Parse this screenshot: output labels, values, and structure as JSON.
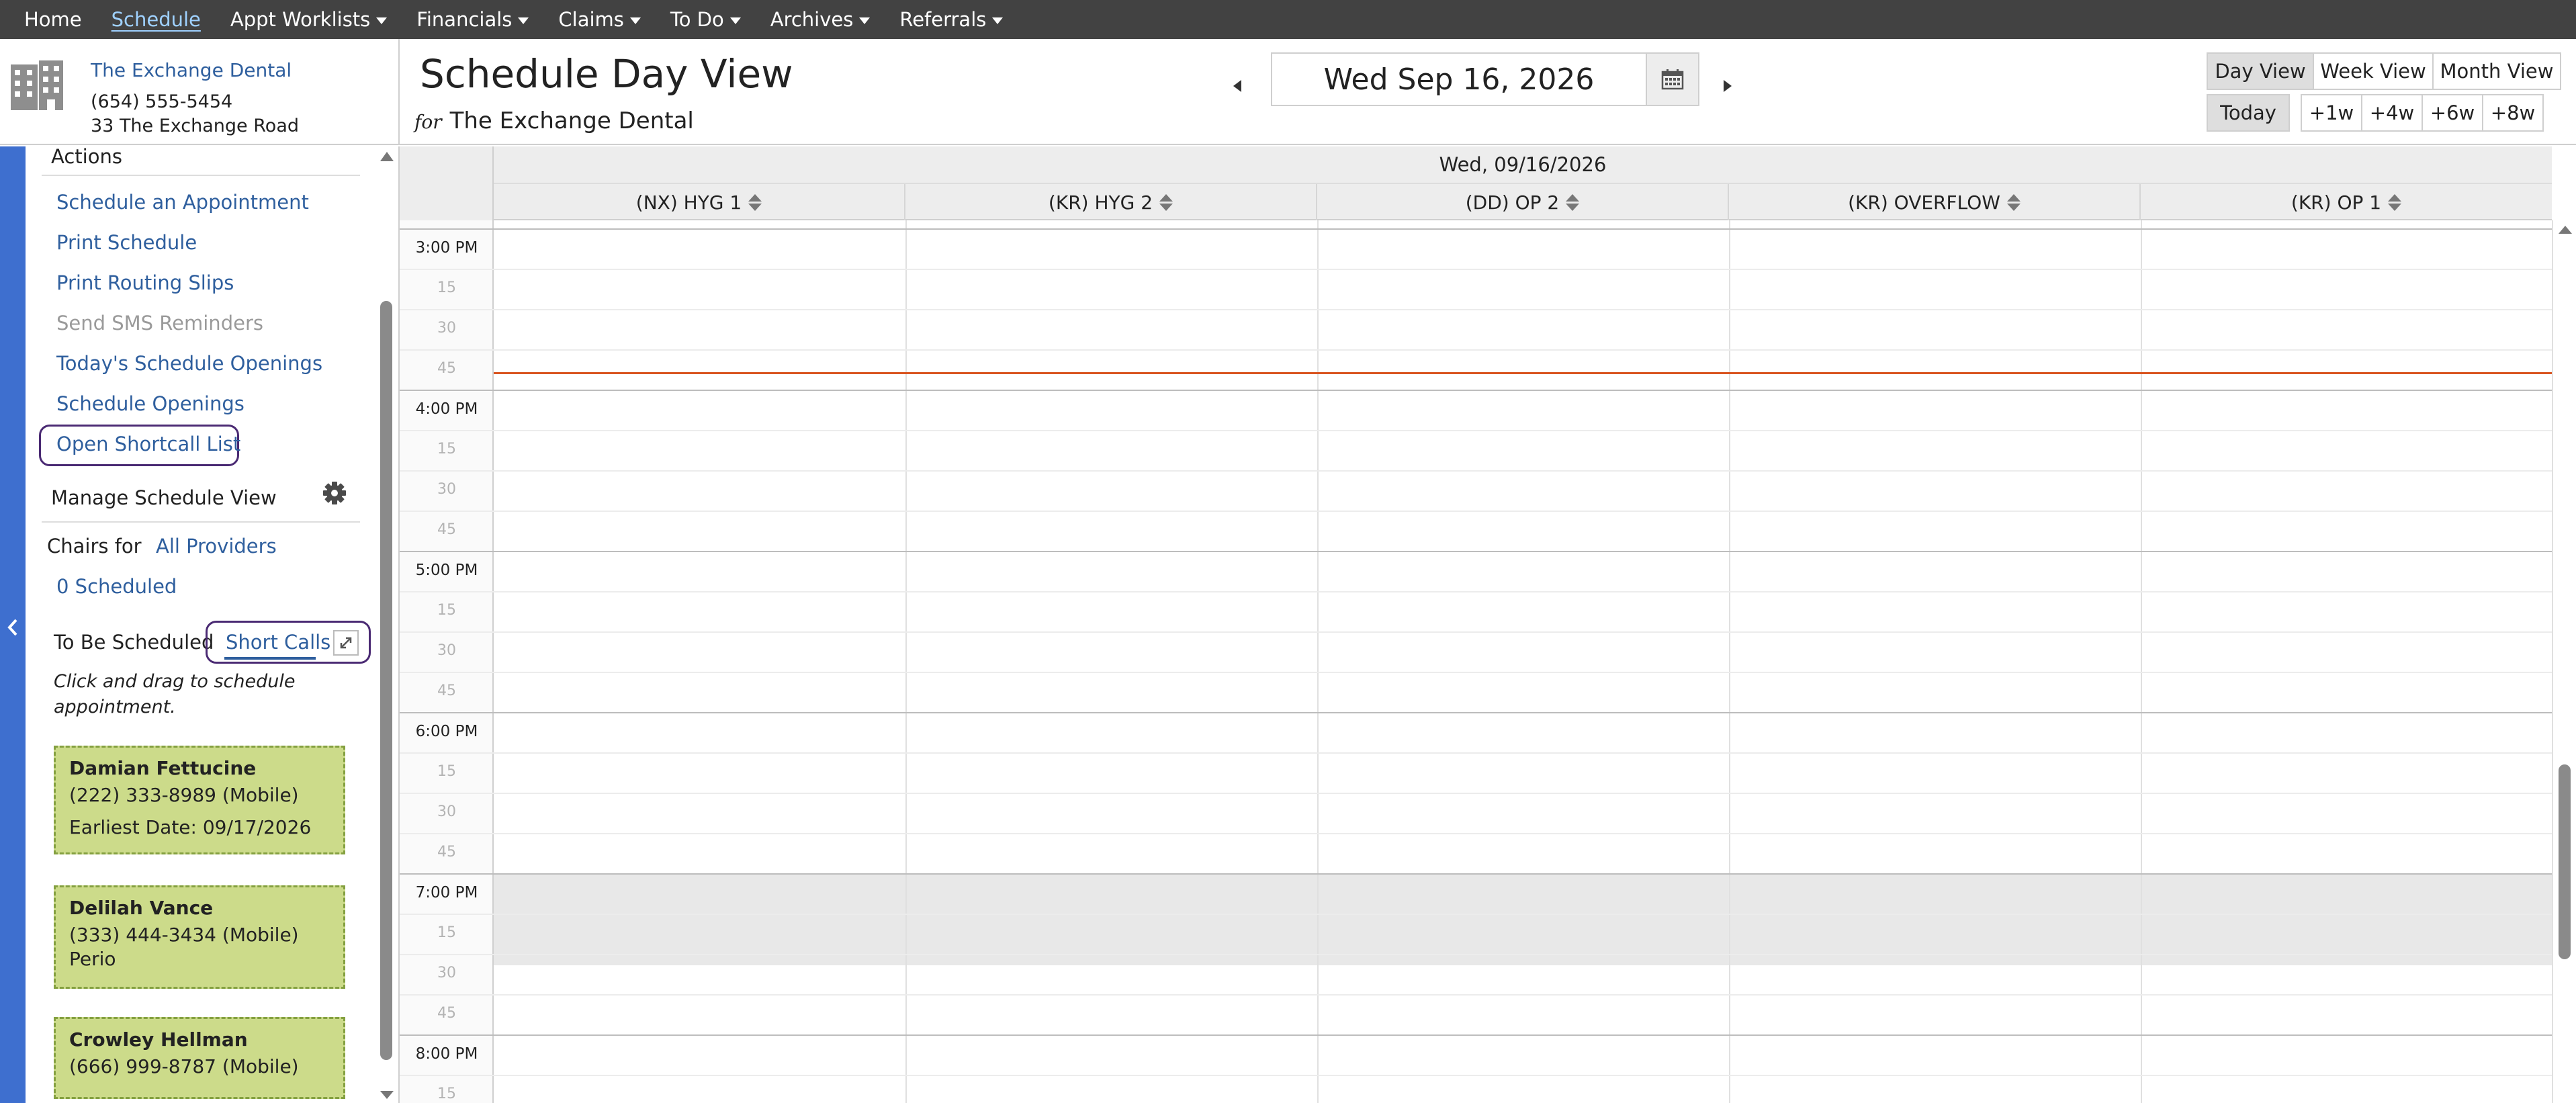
{
  "nav": {
    "items": [
      {
        "label": "Home",
        "dropdown": false,
        "active": false
      },
      {
        "label": "Schedule",
        "dropdown": false,
        "active": true
      },
      {
        "label": "Appt Worklists",
        "dropdown": true,
        "active": false
      },
      {
        "label": "Financials",
        "dropdown": true,
        "active": false
      },
      {
        "label": "Claims",
        "dropdown": true,
        "active": false
      },
      {
        "label": "To Do",
        "dropdown": true,
        "active": false
      },
      {
        "label": "Archives",
        "dropdown": true,
        "active": false
      },
      {
        "label": "Referrals",
        "dropdown": true,
        "active": false
      }
    ]
  },
  "practice": {
    "name": "The Exchange Dental",
    "phone": "(654) 555-5454",
    "address": "33 The Exchange Road",
    "icon": "building-icon"
  },
  "header": {
    "title": "Schedule Day View",
    "for_prefix": "for",
    "for_name": "The Exchange Dental",
    "date": "Wed Sep 16, 2026",
    "views": [
      "Day View",
      "Week View",
      "Month View"
    ],
    "active_view": "Day View",
    "today": "Today",
    "jumps": [
      "+1w",
      "+4w",
      "+6w",
      "+8w"
    ]
  },
  "left": {
    "actions_title": "Actions",
    "actions": [
      {
        "label": "Schedule an Appointment",
        "disabled": false
      },
      {
        "label": "Print Schedule",
        "disabled": false
      },
      {
        "label": "Print Routing Slips",
        "disabled": false
      },
      {
        "label": "Send SMS Reminders",
        "disabled": true
      },
      {
        "label": "Today's Schedule Openings",
        "disabled": false
      },
      {
        "label": "Schedule Openings",
        "disabled": false
      },
      {
        "label": "Open Shortcall List",
        "disabled": false
      }
    ],
    "manage_title": "Manage Schedule View",
    "chairs_for": "Chairs for",
    "chairs_provider": "All Providers",
    "scheduled": "0 Scheduled",
    "to_be_scheduled": "To Be Scheduled",
    "short_calls": "Short Calls",
    "hint": "Click and drag to schedule appointment.",
    "cards": [
      {
        "name": "Damian Fettucine",
        "lines": [
          "(222) 333-8989 (Mobile)",
          "Earliest Date: 09/17/2026"
        ]
      },
      {
        "name": "Delilah Vance",
        "lines": [
          "(333) 444-3434 (Mobile)",
          "Perio"
        ]
      },
      {
        "name": "Crowley Hellman",
        "lines": [
          "(666) 999-8787 (Mobile)"
        ]
      }
    ]
  },
  "grid": {
    "date_header": "Wed, 09/16/2026",
    "columns": [
      "(NX) HYG 1",
      "(KR) HYG 2",
      "(DD) OP 2",
      "(KR) OVERFLOW",
      "(KR) OP 1"
    ],
    "slots": [
      "3:00 PM",
      "15",
      "30",
      "45",
      "4:00 PM",
      "15",
      "30",
      "45",
      "5:00 PM",
      "15",
      "30",
      "45",
      "6:00 PM",
      "15",
      "30",
      "45",
      "7:00 PM",
      "15",
      "30",
      "45",
      "8:00 PM",
      "15"
    ],
    "closed_from_slot": 16
  },
  "colors": {
    "nav_bg": "#424242",
    "link": "#2f5f9e",
    "accent_strip": "#3e6fcf",
    "card_bg": "#ccdb8a",
    "card_border": "#84a040",
    "now_line": "#d9541f",
    "highlight_ring": "#4a2a73"
  }
}
